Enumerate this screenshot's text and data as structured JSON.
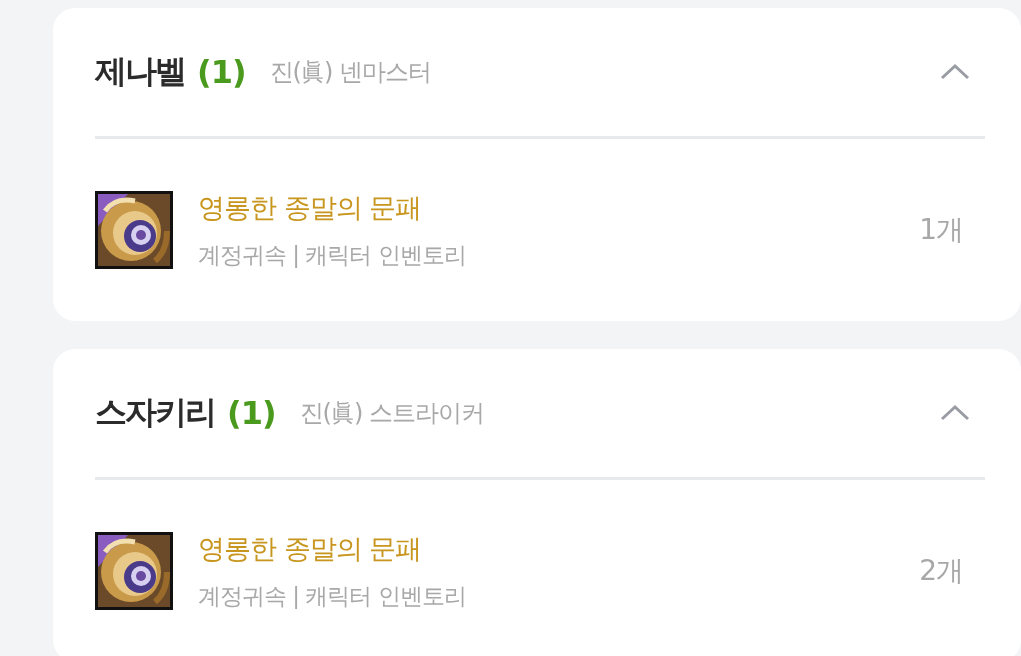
{
  "groups": [
    {
      "name": "제나벨",
      "count": "(1)",
      "class": "진(眞) 넨마스터",
      "expanded": true,
      "items": [
        {
          "kind": "picture",
          "title": "영롱한 종말의 문패",
          "subtitle": "계정귀속 | 캐릭터 인벤토리",
          "quantity": "1개"
        }
      ]
    },
    {
      "name": "스자키리",
      "count": "(1)",
      "class": "진(眞) 스트라이커",
      "expanded": true,
      "items": [
        {
          "kind": "picture",
          "title": "영롱한 종말의 문패",
          "subtitle": "계정귀속 | 캐릭터 인벤토리",
          "quantity": "2개"
        }
      ]
    }
  ]
}
